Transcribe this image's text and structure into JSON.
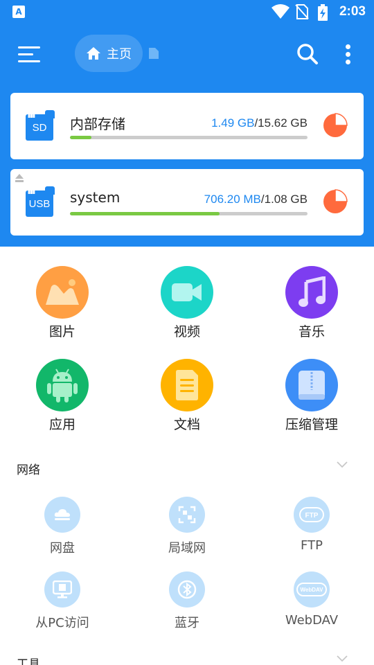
{
  "status_bar": {
    "time": "2:03",
    "app_icon": "A"
  },
  "app_bar": {
    "home_label": "主页"
  },
  "storage": [
    {
      "name": "内部存储",
      "device": "SD",
      "used": "1.49 GB",
      "sep": "/",
      "total": "15.62 GB",
      "fraction": 0.09
    },
    {
      "name": "system",
      "device": "USB",
      "used": "706.20 MB",
      "sep": "/",
      "total": "1.08 GB",
      "fraction": 0.63
    }
  ],
  "categories": [
    {
      "label": "图片",
      "icon": "image-icon",
      "color": "#ff9f43"
    },
    {
      "label": "视频",
      "icon": "video-camera-icon",
      "color": "#1cd5c8"
    },
    {
      "label": "音乐",
      "icon": "music-note-icon",
      "color": "#7d3df0"
    },
    {
      "label": "应用",
      "icon": "android-icon",
      "color": "#12b76a"
    },
    {
      "label": "文档",
      "icon": "document-icon",
      "color": "#ffb300"
    },
    {
      "label": "压缩管理",
      "icon": "archive-icon",
      "color": "#3d8ef7"
    }
  ],
  "network": {
    "title": "网络",
    "items": [
      {
        "label": "网盘",
        "icon": "cloud-icon"
      },
      {
        "label": "局域网",
        "icon": "lan-icon"
      },
      {
        "label": "FTP",
        "icon": "ftp-icon",
        "badge": "FTP"
      },
      {
        "label": "从PC访问",
        "icon": "monitor-icon"
      },
      {
        "label": "蓝牙",
        "icon": "bluetooth-icon"
      },
      {
        "label": "WebDAV",
        "icon": "webdav-icon",
        "badge": "WebDAV"
      }
    ]
  },
  "tools": {
    "title": "工具"
  },
  "colors": {
    "primary": "#1e88f0",
    "progress": "#7ac943",
    "pie": "#ff6a3d",
    "icon_bg": "#bfe0fb"
  }
}
